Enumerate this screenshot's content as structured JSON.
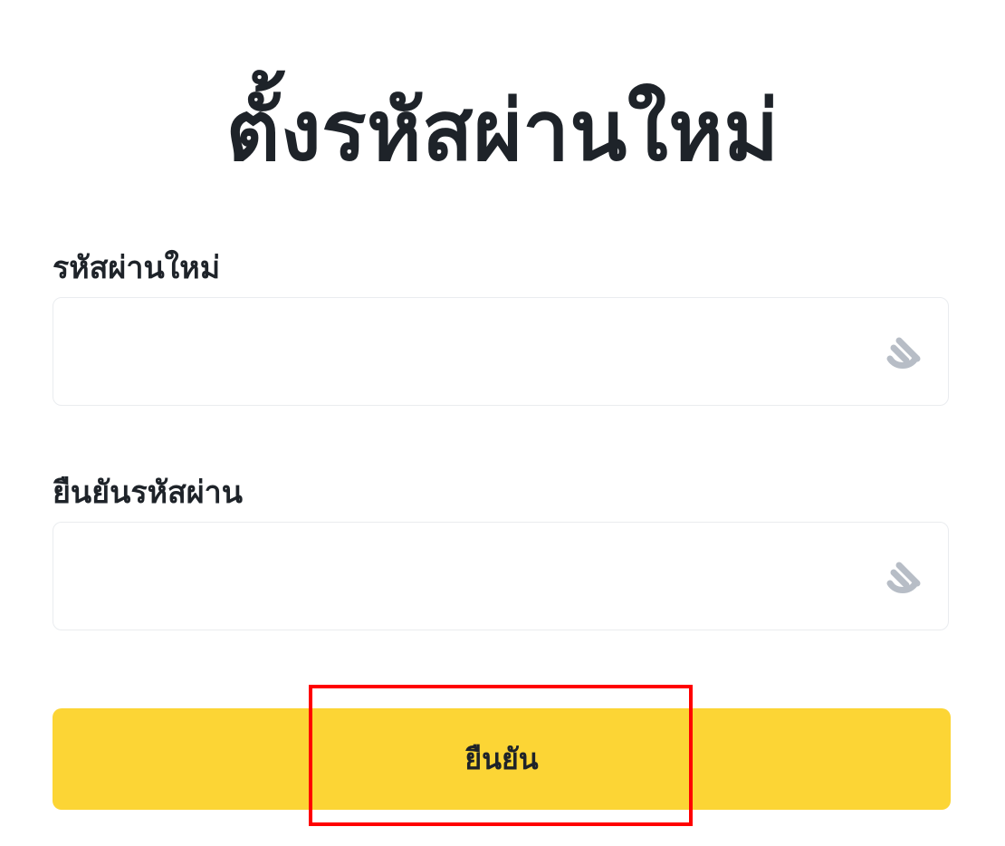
{
  "page": {
    "title": "ตั้งรหัสผ่านใหม่"
  },
  "fields": {
    "new_password": {
      "label": "รหัสผ่านใหม่",
      "value": "",
      "placeholder": ""
    },
    "confirm_password": {
      "label": "ยืนยันรหัสผ่าน",
      "value": "",
      "placeholder": ""
    }
  },
  "icons": {
    "visibility_toggle": "eye-off-icon"
  },
  "actions": {
    "confirm_label": "ยืนยัน"
  },
  "colors": {
    "accent": "#fcd535",
    "text": "#1e2329",
    "icon": "#b7bdc6",
    "border": "#eaecef",
    "highlight": "#ff0000"
  }
}
